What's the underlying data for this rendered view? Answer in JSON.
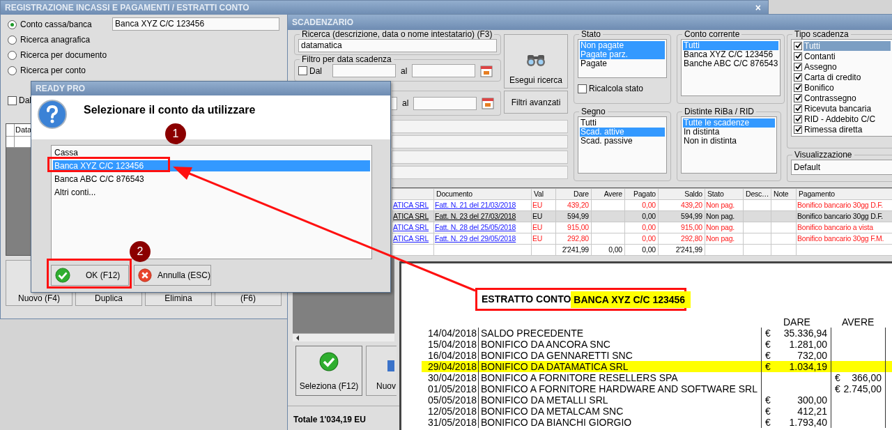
{
  "main_window": {
    "title": "REGISTRAZIONE INCASSI E PAGAMENTI / ESTRATTI CONTO",
    "close": "×",
    "search_modes": [
      {
        "label": "Conto cassa/banca",
        "selected": true
      },
      {
        "label": "Ricerca anagrafica",
        "selected": false
      },
      {
        "label": "Ricerca per documento",
        "selected": false
      },
      {
        "label": "Ricerca per conto",
        "selected": false
      }
    ],
    "account_value": "Banca XYZ C/C 123456",
    "date_filter": {
      "label": "Dal",
      "checked": false
    },
    "table_header": "Data",
    "buttons": [
      "Nuovo (F4)",
      "Duplica",
      "Elimina",
      "(F6)"
    ]
  },
  "scadenzario": {
    "title": "SCADENZARIO",
    "search": {
      "label": "Ricerca (descrizione, data o nome intestatario) (F3)",
      "value": "datamatica"
    },
    "date_filter": {
      "label": "Filtro per data scadenza",
      "checkbox_label": "Dal",
      "checked": false,
      "to_label": "al"
    },
    "second_filter": {
      "to_label": "al"
    },
    "search_button": "Esegui ricerca",
    "advanced_button": "Filtri avanzati",
    "stato": {
      "title": "Stato",
      "items": [
        {
          "label": "Non pagate",
          "selected": true
        },
        {
          "label": "Pagate parz.",
          "selected": true
        },
        {
          "label": "Pagate",
          "selected": false
        }
      ],
      "recalc": {
        "label": "Ricalcola stato",
        "checked": false
      }
    },
    "conto_corrente": {
      "title": "Conto corrente",
      "items": [
        {
          "label": "Tutti",
          "selected": true
        },
        {
          "label": "Banca XYZ C/C 123456",
          "selected": false
        },
        {
          "label": "Banche ABC C/C 876543",
          "selected": false
        }
      ]
    },
    "segno": {
      "title": "Segno",
      "items": [
        {
          "label": "Tutti",
          "selected": false
        },
        {
          "label": "Scad. attive",
          "selected": true
        },
        {
          "label": "Scad. passive",
          "selected": false
        }
      ]
    },
    "distinte": {
      "title": "Distinte RiBa / RID",
      "items": [
        {
          "label": "Tutte le scadenze",
          "selected": true
        },
        {
          "label": "In distinta",
          "selected": false
        },
        {
          "label": "Non in distinta",
          "selected": false
        }
      ]
    },
    "tipo_scadenza": {
      "title": "Tipo scadenza",
      "items": [
        {
          "label": "Tutti",
          "checked": true,
          "selected": true
        },
        {
          "label": "Contanti",
          "checked": true,
          "selected": false
        },
        {
          "label": "Assegno",
          "checked": true,
          "selected": false
        },
        {
          "label": "Carta di credito",
          "checked": true,
          "selected": false
        },
        {
          "label": "Bonifico",
          "checked": true,
          "selected": false
        },
        {
          "label": "Contrassegno",
          "checked": true,
          "selected": false
        },
        {
          "label": "Ricevuta bancaria",
          "checked": true,
          "selected": false
        },
        {
          "label": "RID - Addebito C/C",
          "checked": true,
          "selected": false
        },
        {
          "label": "Rimessa diretta",
          "checked": true,
          "selected": false
        }
      ]
    },
    "visualizzazione": {
      "title": "Visualizzazione",
      "value": "Default"
    },
    "table": {
      "columns": [
        "Documento",
        "Val",
        "Dare",
        "Avere",
        "Pagato",
        "Saldo",
        "Stato",
        "Desc…",
        "Note",
        "Pagamento"
      ],
      "rows": [
        {
          "column_1": "ATICA SRL",
          "documento": "Fatt. N. 21 del 21/03/2018",
          "val": "EU",
          "dare": "439,20",
          "pagato": "0,00",
          "saldo": "439,20",
          "stato": "Non pag.",
          "pagamento": "Bonifico bancario 30gg D.F.",
          "selected": false
        },
        {
          "column_1": "ATICA SRL",
          "documento": "Fatt. N. 23 del 27/03/2018",
          "val": "EU",
          "dare": "594,99",
          "pagato": "0,00",
          "saldo": "594,99",
          "stato": "Non pag.",
          "pagamento": "Bonifico bancario 30gg D.F.",
          "selected": true
        },
        {
          "column_1": "ATICA SRL",
          "documento": "Fatt. N. 28 del 25/05/2018",
          "val": "EU",
          "dare": "915,00",
          "pagato": "0,00",
          "saldo": "915,00",
          "stato": "Non pag.",
          "pagamento": "Bonifico bancario a vista",
          "selected": false
        },
        {
          "column_1": "ATICA SRL",
          "documento": "Fatt. N. 29 del 29/05/2018",
          "val": "EU",
          "dare": "292,80",
          "pagato": "0,00",
          "saldo": "292,80",
          "stato": "Non pag.",
          "pagamento": "Bonifico bancario 30gg F.M.",
          "selected": false
        }
      ],
      "totals": {
        "dare": "2'241,99",
        "avere": "0,00",
        "pagato": "0,00",
        "saldo": "2'241,99"
      }
    },
    "select_button": "Seleziona (F12)",
    "new_button": "Nuov",
    "total": "Totale 1'034,19 EU"
  },
  "dialog": {
    "title": "READY PRO",
    "message": "Selezionare il conto da utilizzare",
    "options": [
      {
        "label": "Cassa",
        "selected": false
      },
      {
        "label": "Banca XYZ C/C 123456",
        "selected": true
      },
      {
        "label": "Banca ABC C/C 876543",
        "selected": false
      },
      {
        "label": "Altri conti...",
        "selected": false
      }
    ],
    "ok": "OK (F12)",
    "cancel": "Annulla (ESC)"
  },
  "statement": {
    "title": "ESTRATTO CONTO",
    "account": "BANCA XYZ C/C 123456",
    "columns": [
      "DARE",
      "AVERE"
    ],
    "rows": [
      {
        "date": "14/04/2018",
        "description": "SALDO PRECEDENTE",
        "dare_currency": "€",
        "dare": "35.336,94",
        "highlighted": false
      },
      {
        "date": "15/04/2018",
        "description": "BONIFICO DA ANCORA SNC",
        "dare_currency": "€",
        "dare": "1.281,00",
        "highlighted": false
      },
      {
        "date": "16/04/2018",
        "description": "BONIFICO DA GENNARETTI SNC",
        "dare_currency": "€",
        "dare": "732,00",
        "highlighted": false
      },
      {
        "date": "29/04/2018",
        "description": "BONIFICO DA DATAMATICA SRL",
        "dare_currency": "€",
        "dare": "1.034,19",
        "highlighted": true
      },
      {
        "date": "30/04/2018",
        "description": "BONIFICO A FORNITORE RESELLERS SPA",
        "avere_currency": "€",
        "avere": "366,00",
        "highlighted": false
      },
      {
        "date": "01/05/2018",
        "description": "BONIFICO A FORNITORE HARDWARE AND SOFTWARE SRL",
        "avere_currency": "€",
        "avere": "2.745,00",
        "highlighted": false
      },
      {
        "date": "05/05/2018",
        "description": "BONIFICO DA METALLI SRL",
        "dare_currency": "€",
        "dare": "300,00",
        "highlighted": false
      },
      {
        "date": "12/05/2018",
        "description": "BONIFICO DA METALCAM SNC",
        "dare_currency": "€",
        "dare": "412,21",
        "highlighted": false
      },
      {
        "date": "31/05/2018",
        "description": "BONIFICO DA BIANCHI GIORGIO",
        "dare_currency": "€",
        "dare": "1.793,40",
        "highlighted": false
      }
    ]
  },
  "annotations": [
    {
      "number": "1"
    },
    {
      "number": "2"
    }
  ]
}
